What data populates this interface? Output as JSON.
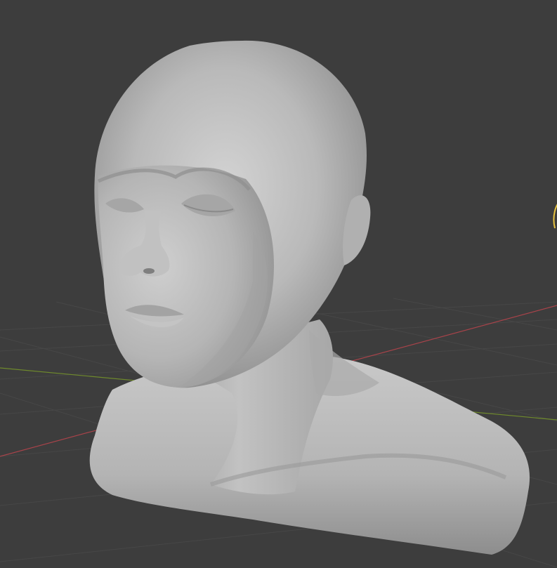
{
  "viewport": {
    "mode": "sculpt",
    "background_color": "#3d3d3d",
    "grid_color": "#4a4a4a",
    "x_axis_color": "#a8434a",
    "y_axis_color": "#6f8a2c",
    "model_color": "#bcbcbc",
    "gizmo_color": "#e8c341"
  },
  "scene": {
    "object": "sculpted-head-bust",
    "icons": [
      "grid-floor",
      "x-axis-line",
      "y-axis-line",
      "sculpt-brush-cursor"
    ]
  }
}
